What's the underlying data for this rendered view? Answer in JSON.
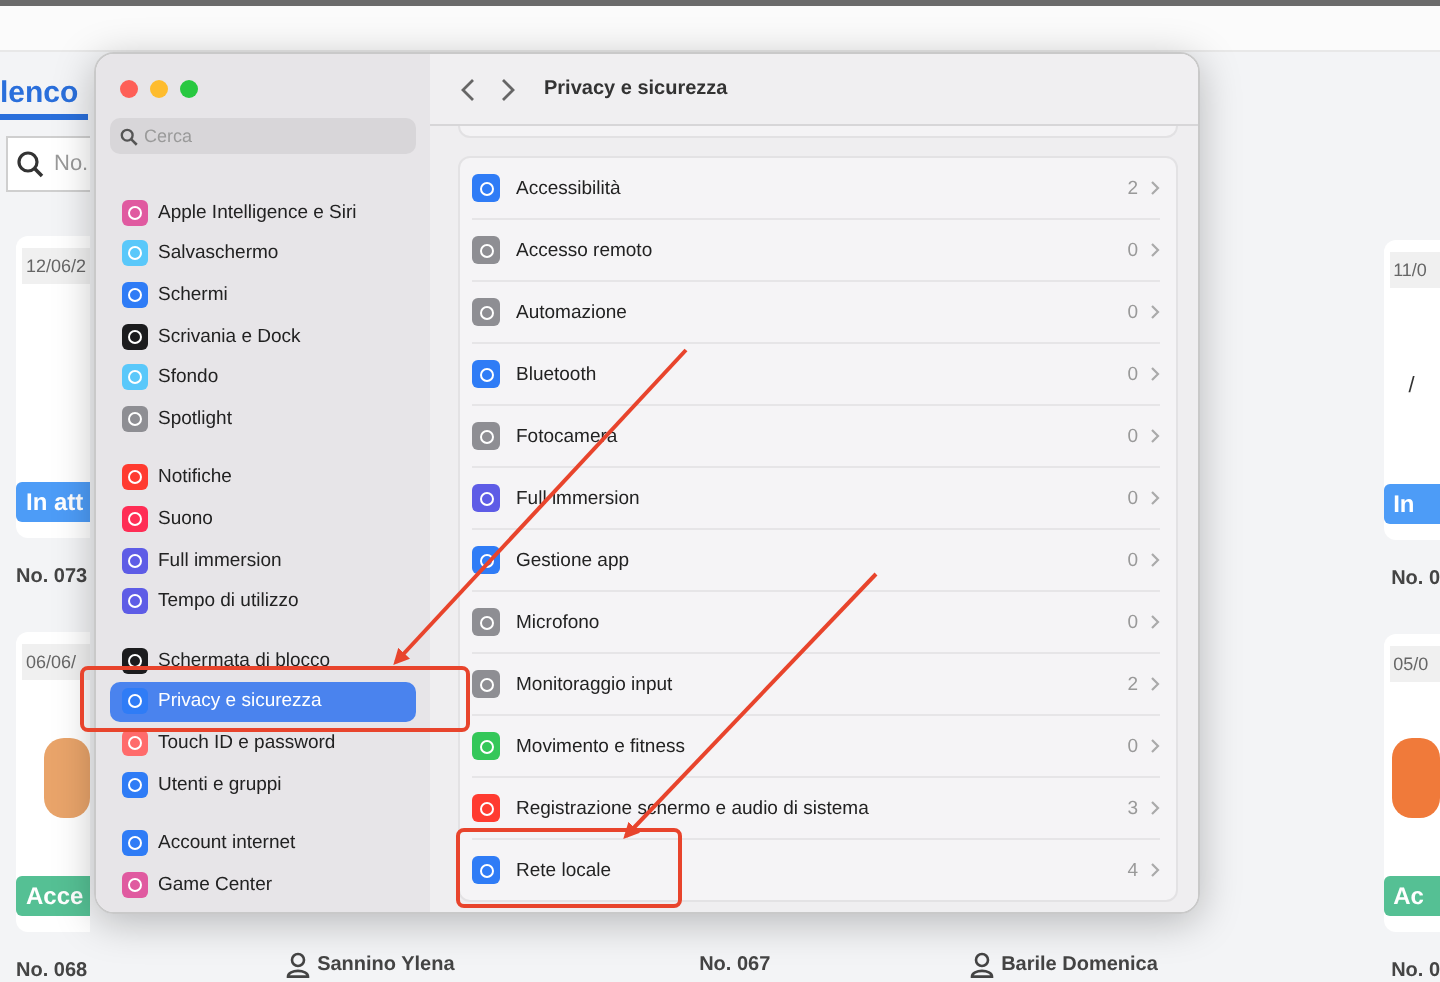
{
  "background": {
    "tab_title": "lenco",
    "search_placeholder": "No.",
    "left_column": [
      {
        "date": "12/06/2",
        "picture": false,
        "status": {
          "label": "In att",
          "kind": "pending"
        },
        "number": "No. 073"
      },
      {
        "date": "06/06/",
        "picture": true,
        "status": {
          "label": "Acce",
          "kind": "accepted"
        },
        "number": "No. 068"
      }
    ],
    "bottom_row": [
      {
        "kind": "owner",
        "text": "Sannino Ylena"
      },
      {
        "kind": "number",
        "text": "No. 067"
      },
      {
        "kind": "owner",
        "text": "Barile Domenica"
      }
    ],
    "right_column": [
      {
        "date": "11/0",
        "note": "/",
        "picture": false,
        "status": {
          "label": "In",
          "kind": "pending"
        },
        "number": "No. 0"
      },
      {
        "date": "05/0",
        "picture": true,
        "status": {
          "label": "Ac",
          "kind": "accepted"
        },
        "number": "No. 0"
      }
    ]
  },
  "settings_window": {
    "search_placeholder": "Cerca",
    "title": "Privacy e sicurezza",
    "sidebar_groups": [
      [
        {
          "label": "Apple Intelligence e Siri",
          "color": "#e05aa0",
          "selected": false
        },
        {
          "label": "Salvaschermo",
          "color": "#5ac8fa",
          "selected": false
        },
        {
          "label": "Schermi",
          "color": "#2f7cf6",
          "selected": false
        },
        {
          "label": "Scrivania e Dock",
          "color": "#1c1c1e",
          "selected": false
        },
        {
          "label": "Sfondo",
          "color": "#5ac8fa",
          "selected": false
        },
        {
          "label": "Spotlight",
          "color": "#8e8e93",
          "selected": false
        }
      ],
      [
        {
          "label": "Notifiche",
          "color": "#ff3b30",
          "selected": false
        },
        {
          "label": "Suono",
          "color": "#ff2d55",
          "selected": false
        },
        {
          "label": "Full immersion",
          "color": "#5e5ce6",
          "selected": false
        },
        {
          "label": "Tempo di utilizzo",
          "color": "#5e5ce6",
          "selected": false
        }
      ],
      [
        {
          "label": "Schermata di blocco",
          "color": "#1c1c1e",
          "selected": false
        },
        {
          "label": "Privacy e sicurezza",
          "color": "#2f7cf6",
          "selected": true
        },
        {
          "label": "Touch ID e password",
          "color": "#ff6b6b",
          "selected": false
        },
        {
          "label": "Utenti e gruppi",
          "color": "#2f7cf6",
          "selected": false
        }
      ],
      [
        {
          "label": "Account internet",
          "color": "#2f7cf6",
          "selected": false
        },
        {
          "label": "Game Center",
          "color": "#e05aa0",
          "selected": false
        }
      ]
    ],
    "rows": [
      {
        "label": "Accessibilità",
        "count": "2",
        "color": "#2f7cf6"
      },
      {
        "label": "Accesso remoto",
        "count": "0",
        "color": "#8e8e93"
      },
      {
        "label": "Automazione",
        "count": "0",
        "color": "#8e8e93"
      },
      {
        "label": "Bluetooth",
        "count": "0",
        "color": "#2f7cf6"
      },
      {
        "label": "Fotocamera",
        "count": "0",
        "color": "#8e8e93"
      },
      {
        "label": "Full immersion",
        "count": "0",
        "color": "#5e5ce6"
      },
      {
        "label": "Gestione app",
        "count": "0",
        "color": "#2f7cf6"
      },
      {
        "label": "Microfono",
        "count": "0",
        "color": "#8e8e93"
      },
      {
        "label": "Monitoraggio input",
        "count": "2",
        "color": "#8e8e93"
      },
      {
        "label": "Movimento e fitness",
        "count": "0",
        "color": "#34c759"
      },
      {
        "label": "Registrazione schermo e audio di sistema",
        "count": "3",
        "color": "#ff3b30"
      },
      {
        "label": "Rete locale",
        "count": "4",
        "color": "#2f7cf6"
      }
    ]
  }
}
